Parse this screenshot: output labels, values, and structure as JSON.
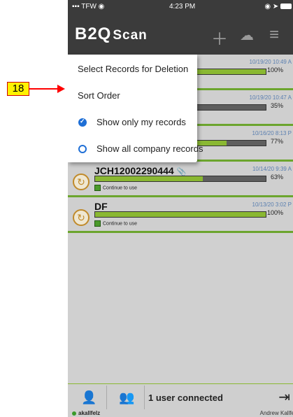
{
  "status_bar": {
    "carrier": "TFW",
    "time": "4:23 PM"
  },
  "header": {
    "logo_main": "B2Q",
    "logo_sub": "Scan"
  },
  "menu": {
    "items": [
      {
        "label": "Select Records for Deletion"
      },
      {
        "label": "Sort Order"
      },
      {
        "label": "Show only my records",
        "selected": true
      },
      {
        "label": "Show all company records",
        "selected": false
      }
    ]
  },
  "records": [
    {
      "name": "",
      "date": "10/19/20 10:49 A",
      "progress": 100,
      "progress_label": "100%",
      "status": ""
    },
    {
      "name": "",
      "date": "10/19/20 10:47 A",
      "progress": 35,
      "progress_label": "35%",
      "status": ""
    },
    {
      "name": "",
      "date": "10/16/20 8:13 P",
      "progress": 77,
      "progress_label": "77%",
      "status": ""
    },
    {
      "name": "JCH12002290444",
      "date": "10/14/20 9:39 A",
      "progress": 63,
      "progress_label": "63%",
      "status": "Continue to use"
    },
    {
      "name": "DF",
      "date": "10/13/20 3:02 P",
      "progress": 100,
      "progress_label": "100%",
      "status": "Continue to use"
    }
  ],
  "footer": {
    "connected": "1 user connected",
    "user_left": "akallfelz",
    "user_right": "Andrew Kallfe"
  },
  "annotation": {
    "label": "18"
  },
  "colors": {
    "header_bg": "#3b3b3b",
    "accent_green": "#8ab832",
    "radio_blue": "#1f6fd6",
    "callout_yellow": "#fff200",
    "arrow_red": "#ff0000"
  }
}
